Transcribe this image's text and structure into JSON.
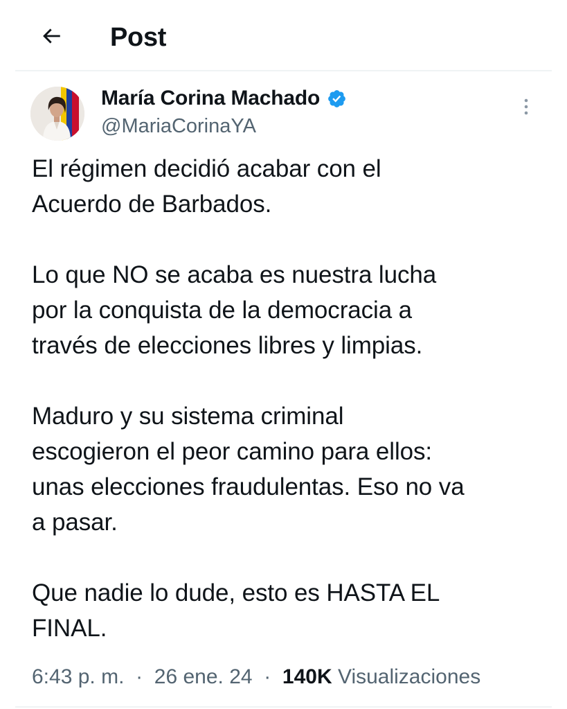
{
  "header": {
    "back_icon": "arrow-left-icon",
    "title": "Post"
  },
  "author": {
    "name": "María Corina Machado",
    "handle": "@MariaCorinaYA",
    "verified_icon": "verified-badge-icon",
    "verified_color": "#1d9bf0",
    "more_icon": "more-vertical-icon"
  },
  "tweet": {
    "paragraphs": [
      "El régimen decidió acabar con el\nAcuerdo de Barbados.",
      "Lo que NO se acaba es nuestra lucha\npor la conquista de la democracia a\ntravés de elecciones libres y limpias.",
      "Maduro y su sistema criminal\nescogieron el peor camino para ellos:\nunas elecciones fraudulentas. Eso no va\na pasar.",
      "Que nadie lo dude, esto es HASTA EL\nFINAL."
    ]
  },
  "meta": {
    "time": "6:43 p. m.",
    "separator": "·",
    "date": "26 ene. 24",
    "views_count": "140K",
    "views_label": "Visualizaciones"
  },
  "colors": {
    "text_primary": "#0f1419",
    "text_secondary": "#536471",
    "divider": "#eff3f4"
  }
}
